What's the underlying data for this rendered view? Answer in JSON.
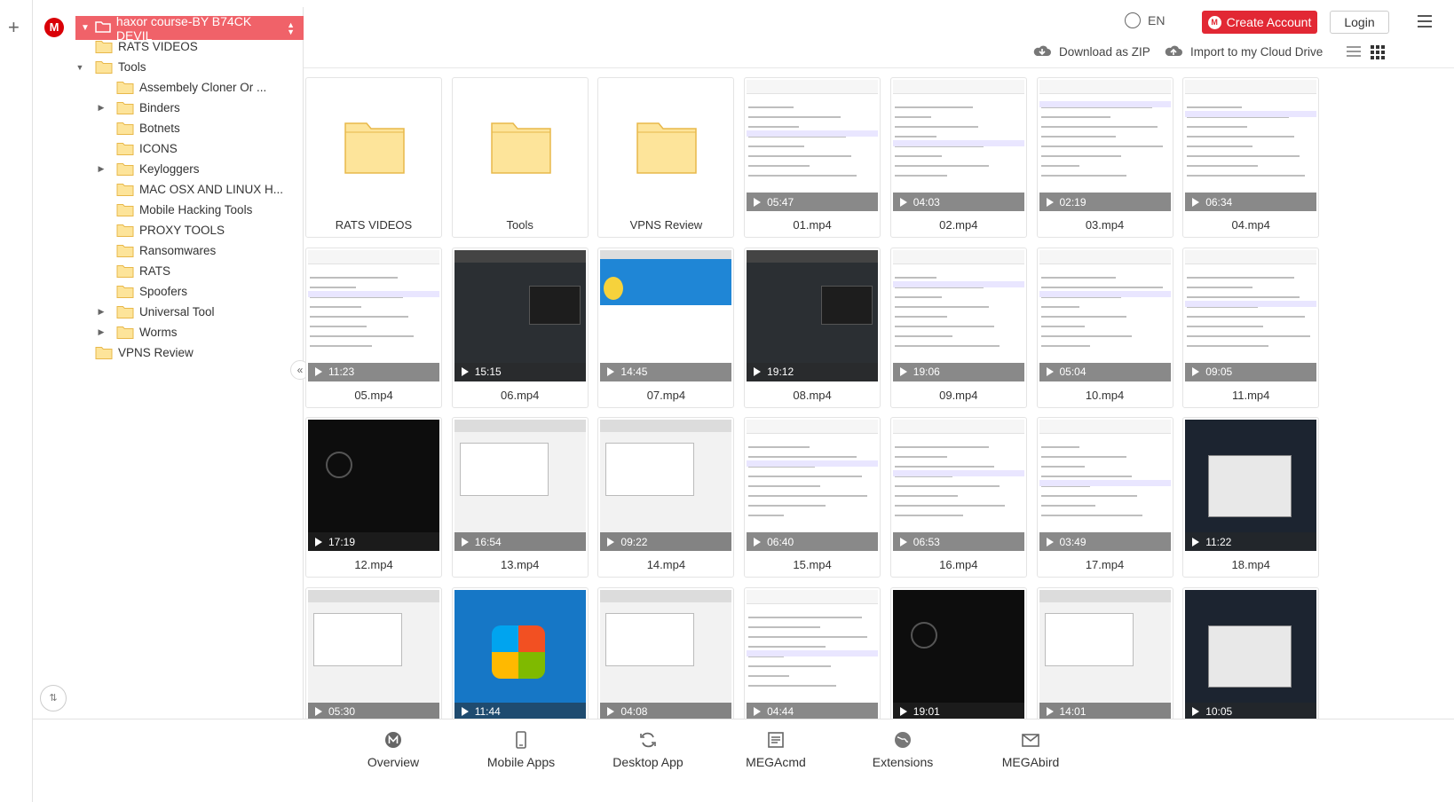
{
  "header": {
    "lang": "EN",
    "create_account": "Create Account",
    "login": "Login"
  },
  "actions": {
    "download_zip": "Download as ZIP",
    "import_cloud": "Import to my Cloud Drive"
  },
  "tree": {
    "root": "haxor course-BY B74CK DEVIL",
    "items": [
      {
        "label": "RATS VIDEOS",
        "level": 0,
        "expander": ""
      },
      {
        "label": "Tools",
        "level": 0,
        "expander": "▼"
      },
      {
        "label": "Assembely Cloner Or ...",
        "level": 1,
        "expander": ""
      },
      {
        "label": "Binders",
        "level": 1,
        "expander": "▶"
      },
      {
        "label": "Botnets",
        "level": 1,
        "expander": ""
      },
      {
        "label": "ICONS",
        "level": 1,
        "expander": ""
      },
      {
        "label": "Keyloggers",
        "level": 1,
        "expander": "▶"
      },
      {
        "label": "MAC OSX AND LINUX H...",
        "level": 1,
        "expander": ""
      },
      {
        "label": "Mobile Hacking Tools",
        "level": 1,
        "expander": ""
      },
      {
        "label": "PROXY TOOLS",
        "level": 1,
        "expander": ""
      },
      {
        "label": "Ransomwares",
        "level": 1,
        "expander": ""
      },
      {
        "label": "RATS",
        "level": 1,
        "expander": ""
      },
      {
        "label": "Spoofers",
        "level": 1,
        "expander": ""
      },
      {
        "label": "Universal Tool",
        "level": 1,
        "expander": "▶"
      },
      {
        "label": "Worms",
        "level": 1,
        "expander": "▶"
      },
      {
        "label": "VPNS Review",
        "level": 0,
        "expander": ""
      }
    ]
  },
  "grid_items": [
    {
      "name": "RATS VIDEOS",
      "kind": "folder"
    },
    {
      "name": "Tools",
      "kind": "folder"
    },
    {
      "name": "VPNS Review",
      "kind": "folder"
    },
    {
      "name": "01.mp4",
      "kind": "video",
      "duration": "05:47",
      "style": "doc"
    },
    {
      "name": "02.mp4",
      "kind": "video",
      "duration": "04:03",
      "style": "doc"
    },
    {
      "name": "03.mp4",
      "kind": "video",
      "duration": "02:19",
      "style": "doc"
    },
    {
      "name": "04.mp4",
      "kind": "video",
      "duration": "06:34",
      "style": "doc"
    },
    {
      "name": "05.mp4",
      "kind": "video",
      "duration": "11:23",
      "style": "doc"
    },
    {
      "name": "06.mp4",
      "kind": "video",
      "duration": "15:15",
      "style": "dark"
    },
    {
      "name": "07.mp4",
      "kind": "video",
      "duration": "14:45",
      "style": "duck"
    },
    {
      "name": "08.mp4",
      "kind": "video",
      "duration": "19:12",
      "style": "dark"
    },
    {
      "name": "09.mp4",
      "kind": "video",
      "duration": "19:06",
      "style": "table"
    },
    {
      "name": "10.mp4",
      "kind": "video",
      "duration": "05:04",
      "style": "doc"
    },
    {
      "name": "11.mp4",
      "kind": "video",
      "duration": "09:05",
      "style": "doc"
    },
    {
      "name": "12.mp4",
      "kind": "video",
      "duration": "17:19",
      "style": "black"
    },
    {
      "name": "13.mp4",
      "kind": "video",
      "duration": "16:54",
      "style": "gray"
    },
    {
      "name": "14.mp4",
      "kind": "video",
      "duration": "09:22",
      "style": "gray"
    },
    {
      "name": "15.mp4",
      "kind": "video",
      "duration": "06:40",
      "style": "doc"
    },
    {
      "name": "16.mp4",
      "kind": "video",
      "duration": "06:53",
      "style": "doc"
    },
    {
      "name": "17.mp4",
      "kind": "video",
      "duration": "03:49",
      "style": "doc"
    },
    {
      "name": "18.mp4",
      "kind": "video",
      "duration": "11:22",
      "style": "desk"
    },
    {
      "name": "",
      "kind": "video",
      "duration": "05:30",
      "style": "gray"
    },
    {
      "name": "",
      "kind": "video",
      "duration": "11:44",
      "style": "blue"
    },
    {
      "name": "",
      "kind": "video",
      "duration": "04:08",
      "style": "gray"
    },
    {
      "name": "",
      "kind": "video",
      "duration": "04:44",
      "style": "doc"
    },
    {
      "name": "",
      "kind": "video",
      "duration": "19:01",
      "style": "black"
    },
    {
      "name": "",
      "kind": "video",
      "duration": "14:01",
      "style": "gray"
    },
    {
      "name": "",
      "kind": "video",
      "duration": "10:05",
      "style": "desk"
    }
  ],
  "bottom_nav": [
    {
      "label": "Overview",
      "icon": "mega-icon"
    },
    {
      "label": "Mobile Apps",
      "icon": "phone-icon"
    },
    {
      "label": "Desktop App",
      "icon": "sync-icon"
    },
    {
      "label": "MEGAcmd",
      "icon": "terminal-icon"
    },
    {
      "label": "Extensions",
      "icon": "globe-icon"
    },
    {
      "label": "MEGAbird",
      "icon": "mail-icon"
    }
  ],
  "colors": {
    "accent": "#e22834",
    "tree_root_bg": "#f06269",
    "folder_fill": "#fde49a",
    "folder_stroke": "#e8b84a"
  }
}
